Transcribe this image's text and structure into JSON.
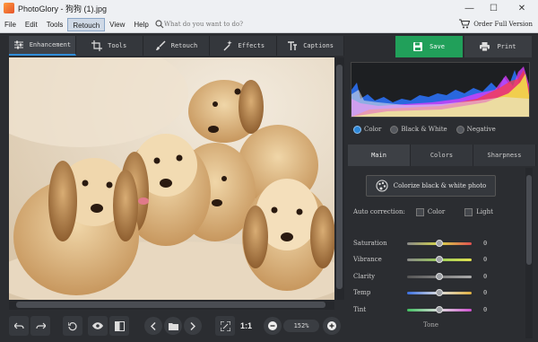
{
  "window": {
    "title": "PhotoGlory - 狗狗 (1).jpg",
    "minimize": "—",
    "maximize": "☐",
    "close": "✕"
  },
  "menu": {
    "items": [
      "File",
      "Edit",
      "Tools",
      "Retouch",
      "View",
      "Help"
    ],
    "active": "Retouch",
    "search_placeholder": "What do you want to do?",
    "order_label": "Order Full Version"
  },
  "tool_tabs": [
    {
      "label": "Enhancement",
      "icon": "sliders-icon",
      "active": true
    },
    {
      "label": "Tools",
      "icon": "crop-icon",
      "active": false
    },
    {
      "label": "Retouch",
      "icon": "brush-icon",
      "active": false
    },
    {
      "label": "Effects",
      "icon": "magic-wand-icon",
      "active": false
    },
    {
      "label": "Captions",
      "icon": "text-icon",
      "active": false
    }
  ],
  "actions": {
    "save_label": "Save",
    "print_label": "Print"
  },
  "color_modes": [
    {
      "label": "Color",
      "selected": true
    },
    {
      "label": "Black & White",
      "selected": false
    },
    {
      "label": "Negative",
      "selected": false
    }
  ],
  "panel_tabs": [
    {
      "label": "Main",
      "active": true
    },
    {
      "label": "Colors",
      "active": false
    },
    {
      "label": "Sharpness",
      "active": false
    }
  ],
  "colorize_label": "Colorize black & white photo",
  "auto_correction": {
    "label": "Auto correction:",
    "color": "Color",
    "light": "Light"
  },
  "sliders": [
    {
      "label": "Saturation",
      "value": "0",
      "level": 0.5
    },
    {
      "label": "Vibrance",
      "value": "0",
      "level": 0.5
    },
    {
      "label": "Clarity",
      "value": "0",
      "level": 0.5
    },
    {
      "label": "Temp",
      "value": "0",
      "level": 0.5
    },
    {
      "label": "Tint",
      "value": "0",
      "level": 0.5
    }
  ],
  "bottom_bar": {
    "one_to_one": "1:1",
    "zoom": "152%"
  },
  "partial_label": "Tone"
}
